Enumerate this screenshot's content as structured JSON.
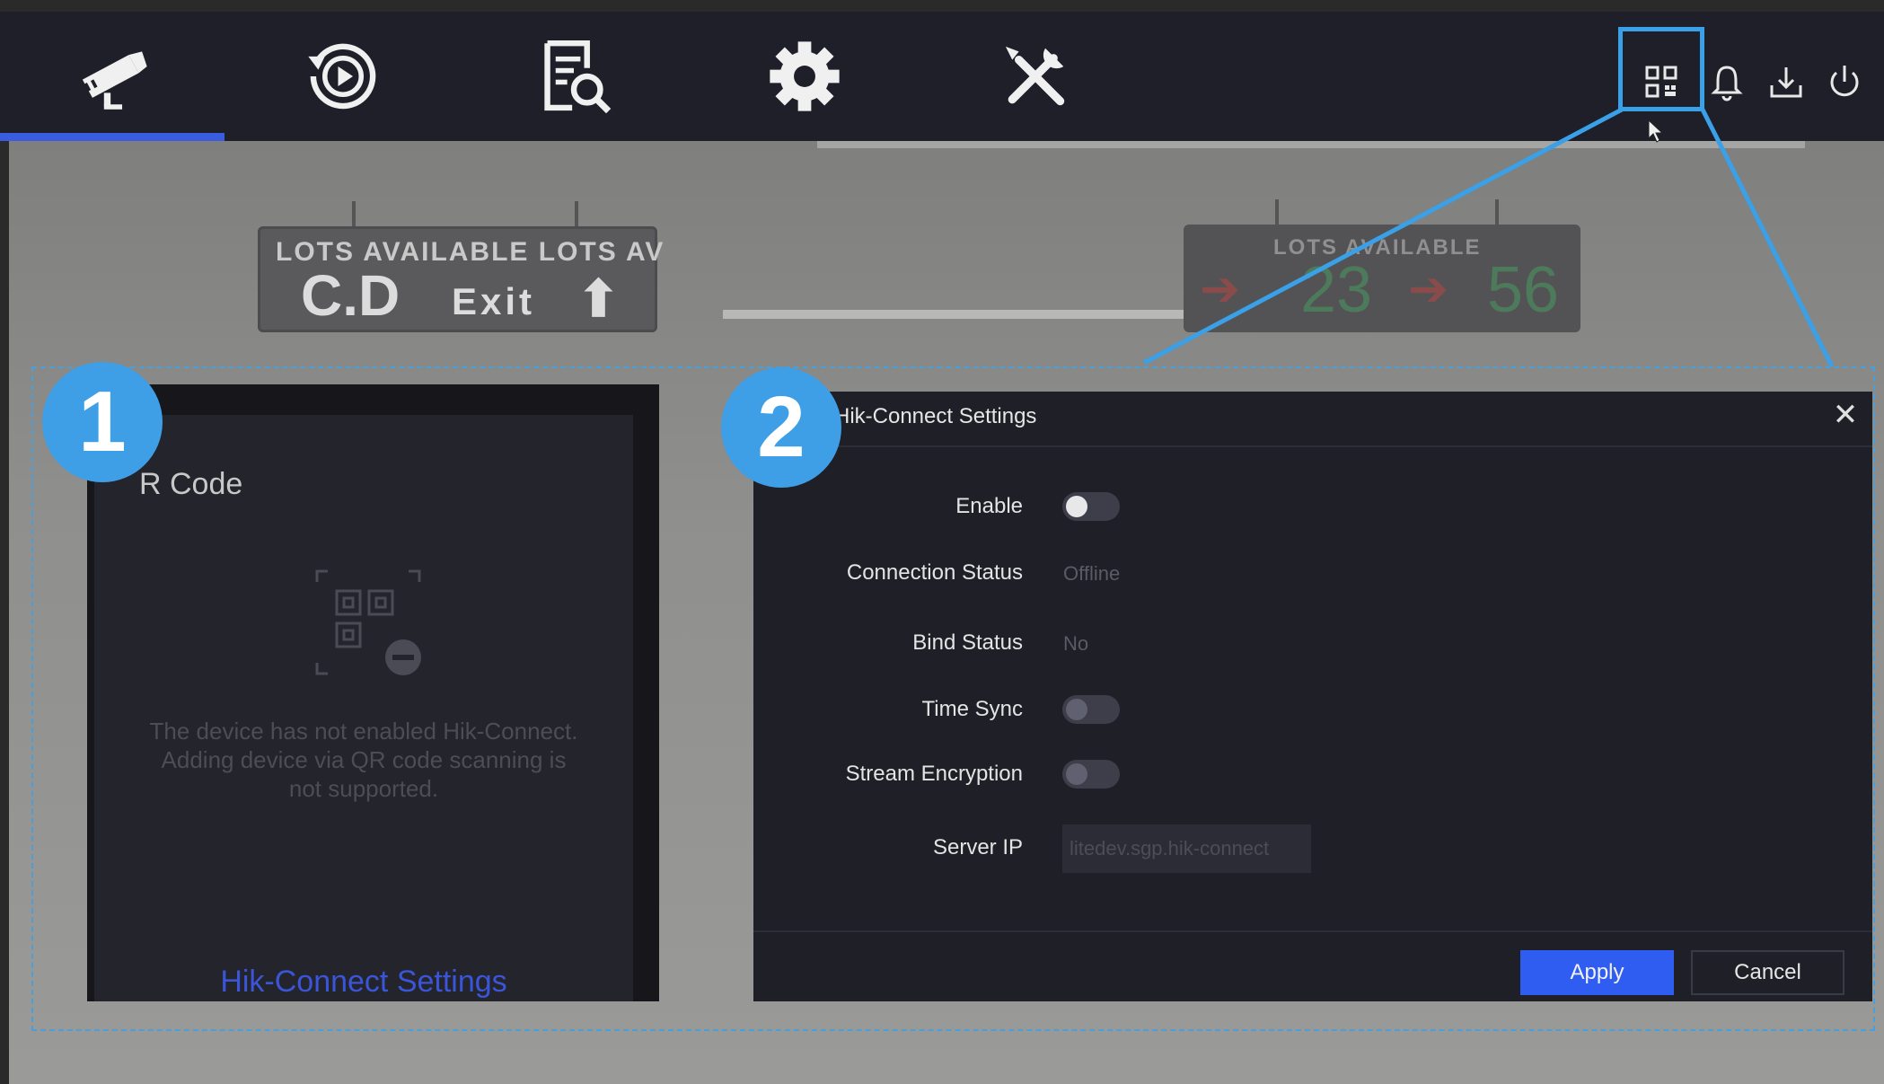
{
  "navbar": {
    "items": [
      {
        "id": "live-view",
        "icon": "camera-icon",
        "active": true
      },
      {
        "id": "playback",
        "icon": "playback-icon",
        "active": false
      },
      {
        "id": "search",
        "icon": "file-search-icon",
        "active": false
      },
      {
        "id": "configuration",
        "icon": "gear-icon",
        "active": false
      },
      {
        "id": "maintenance",
        "icon": "tools-icon",
        "active": false
      }
    ],
    "right_icons": [
      "qr-code-icon",
      "bell-icon",
      "download-icon",
      "power-icon"
    ]
  },
  "scene": {
    "sign_left": {
      "top": "LOTS AVAILABLE LOTS AV",
      "main": "C.D",
      "exit": "Exit",
      "arrow": "⬆"
    },
    "sign_right": {
      "top": "LOTS AVAILABLE",
      "num1": "23",
      "num2": "56"
    }
  },
  "badges": {
    "one": "1",
    "two": "2"
  },
  "panel1": {
    "title": "R Code",
    "message": "The device has not enabled Hik-Connect. Adding device via QR code scanning is not supported.",
    "link": "Hik-Connect Settings"
  },
  "panel2": {
    "title": "Hik-Connect Settings",
    "close": "✕",
    "enable_label": "Enable",
    "connection_status_label": "Connection Status",
    "connection_status_value": "Offline",
    "bind_status_label": "Bind Status",
    "bind_status_value": "No",
    "time_sync_label": "Time Sync",
    "stream_encryption_label": "Stream Encryption",
    "server_ip_label": "Server IP",
    "server_ip_value": "litedev.sgp.hik-connect",
    "apply": "Apply",
    "cancel": "Cancel"
  },
  "colors": {
    "accent": "#3e9ee6",
    "apply": "#2f5df2",
    "nav_bg": "#1e1f28"
  }
}
